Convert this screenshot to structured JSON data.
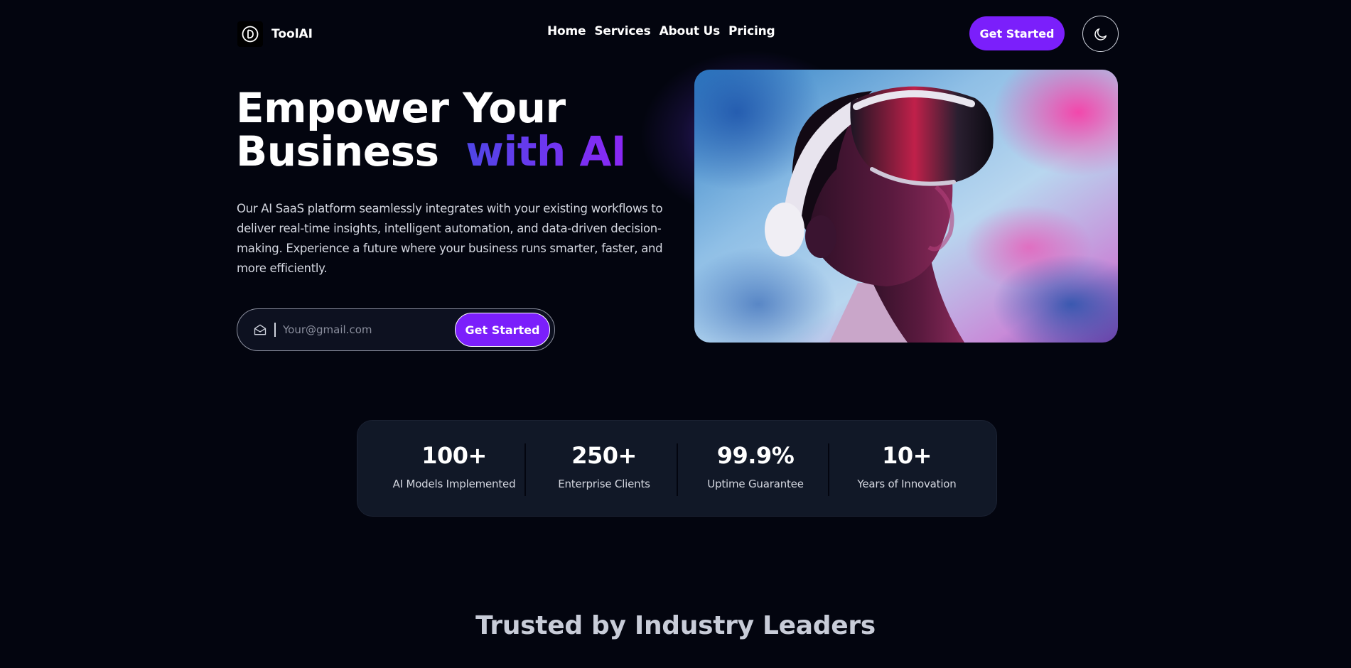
{
  "brand": {
    "name": "ToolAI",
    "logo_icon": "logo-d-circle-icon"
  },
  "nav": {
    "items": [
      {
        "label": "Home"
      },
      {
        "label": "Services"
      },
      {
        "label": "About Us"
      },
      {
        "label": "Pricing"
      }
    ]
  },
  "header": {
    "cta_label": "Get Started",
    "theme_icon": "moon-icon"
  },
  "hero": {
    "title_line1": "Empower Your",
    "title_line2": "Business",
    "title_accent": "with AI",
    "description": "Our AI SaaS platform seamlessly integrates with your existing workflows to deliver real-time insights, intelligent automation, and data-driven decision-making. Experience a future where your business runs smarter, faster, and more efficiently.",
    "email_placeholder": "Your@gmail.com",
    "email_icon": "envelope-open-icon",
    "form_cta_label": "Get Started"
  },
  "stats": [
    {
      "value": "100+",
      "label": "AI Models Implemented"
    },
    {
      "value": "250+",
      "label": "Enterprise Clients"
    },
    {
      "value": "99.9%",
      "label": "Uptime Guarantee"
    },
    {
      "value": "10+",
      "label": "Years of Innovation"
    }
  ],
  "trusted": {
    "title": "Trusted by Industry Leaders"
  },
  "colors": {
    "background": "#03050f",
    "accent_purple": "#7b1ffb",
    "gradient_start": "#4f46e5",
    "gradient_end": "#8b27f5",
    "card": "#111827"
  }
}
